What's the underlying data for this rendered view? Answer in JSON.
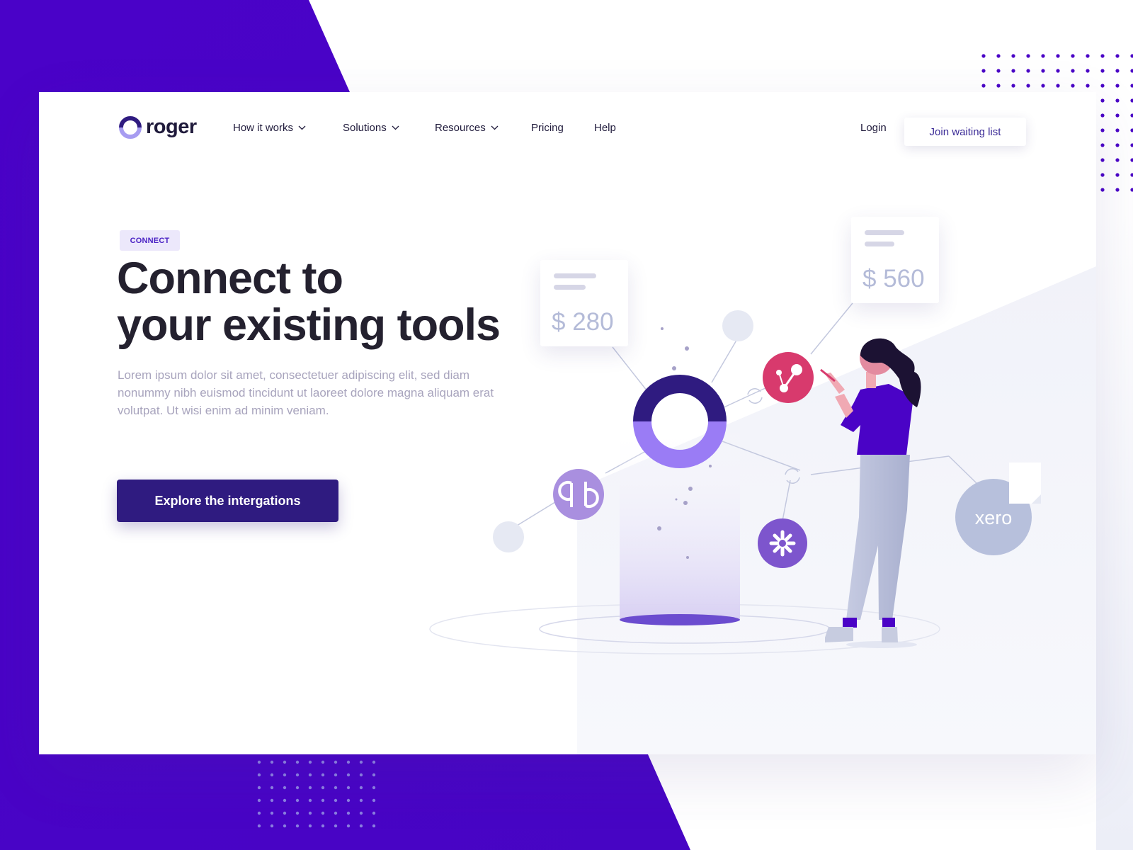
{
  "brand": {
    "name": "roger",
    "accent": "#4a03c6",
    "dark": "#2f1b80"
  },
  "nav": {
    "items": [
      {
        "label": "How it works",
        "dropdown": true
      },
      {
        "label": "Solutions",
        "dropdown": true
      },
      {
        "label": "Resources",
        "dropdown": true
      },
      {
        "label": "Pricing",
        "dropdown": false
      },
      {
        "label": "Help",
        "dropdown": false
      }
    ],
    "login": "Login",
    "join": "Join waiting list"
  },
  "hero": {
    "badge": "CONNECT",
    "title_line1": "Connect to",
    "title_line2": "your existing tools",
    "description": "Lorem ipsum dolor sit amet, consectetuer adipiscing elit, sed diam nonummy nibh euismod tincidunt ut laoreet dolore magna aliquam erat volutpat. Ut wisi enim ad minim veniam.",
    "cta": "Explore the intergations"
  },
  "illustration": {
    "price_cards": [
      {
        "amount": "$ 280"
      },
      {
        "amount": "$ 560"
      }
    ],
    "integrations": [
      {
        "name": "quickbooks-icon"
      },
      {
        "name": "zapier-icon"
      },
      {
        "name": "nodes-icon"
      },
      {
        "name": "xero-icon",
        "label": "xero"
      }
    ]
  }
}
